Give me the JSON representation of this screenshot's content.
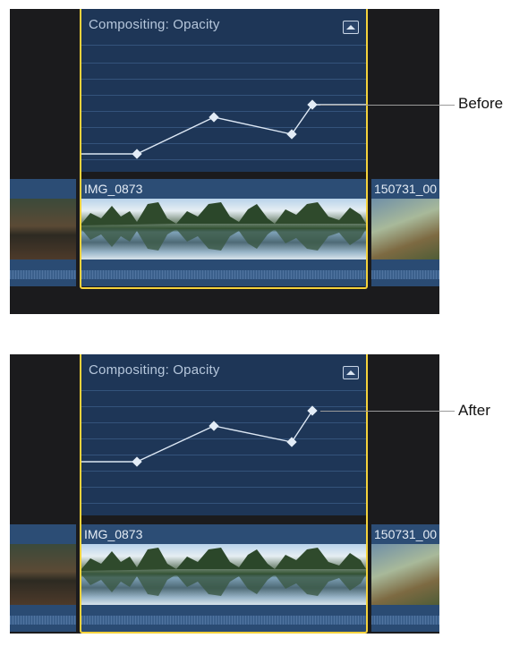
{
  "before": {
    "callout": "Before",
    "effect_label": "Compositing: Opacity",
    "clips": {
      "left": "",
      "main": "IMG_0873",
      "right": "150731_00"
    }
  },
  "after": {
    "callout": "After",
    "effect_label": "Compositing: Opacity",
    "clips": {
      "left": "",
      "main": "IMG_0873",
      "right": "150731_00"
    }
  },
  "icons": {
    "collapse": "collapse-editor-icon"
  },
  "colors": {
    "selection": "#f4d23c",
    "editor_bg": "#1e3657",
    "clip_bg": "#2c4d75"
  }
}
